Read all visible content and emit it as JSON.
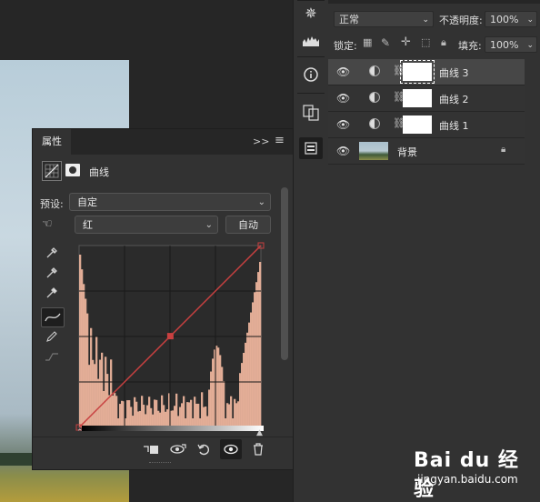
{
  "layers_panel": {
    "blend_mode": "正常",
    "opacity_label": "不透明度:",
    "opacity_value": "100%",
    "lock_label": "锁定:",
    "fill_label": "填充:",
    "fill_value": "100%",
    "layers": [
      {
        "name": "曲线 3",
        "selected": true
      },
      {
        "name": "曲线 2",
        "selected": false
      },
      {
        "name": "曲线 1",
        "selected": false
      },
      {
        "name": "背景",
        "selected": false
      }
    ]
  },
  "properties_panel": {
    "tab_label": "属性",
    "header_expand": ">>",
    "adjustment_type": "曲线",
    "preset_label": "预设:",
    "preset_value": "自定",
    "channel_value": "红",
    "auto_button": "自动"
  },
  "curve": {
    "channel_color": "#c84040",
    "histogram_color": "#f2b8a0",
    "points": [
      [
        0,
        0
      ],
      [
        128,
        128
      ],
      [
        255,
        255
      ]
    ]
  },
  "watermark": {
    "text": "Bai du 经验",
    "url": "jingyan.baidu.com"
  }
}
